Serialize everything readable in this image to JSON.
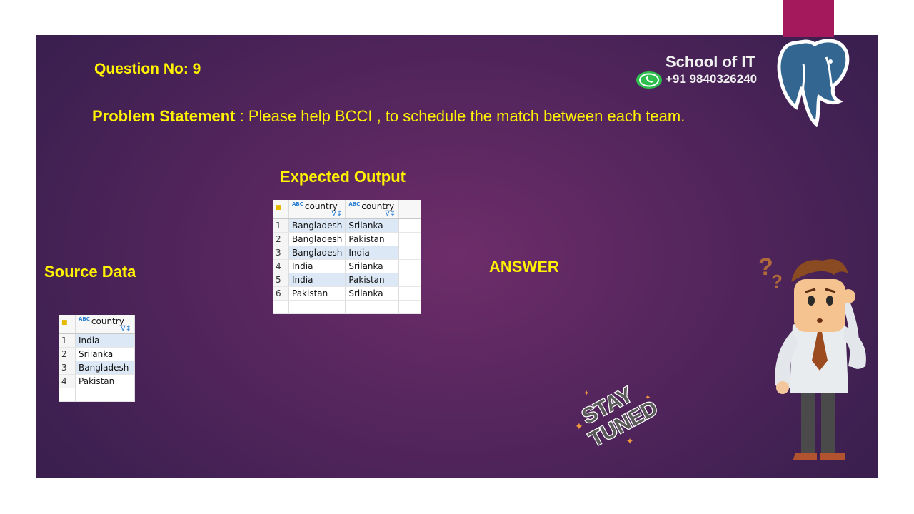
{
  "slide": {
    "question_label": "Question No: 9",
    "problem_label": "Problem Statement",
    "problem_text": " : Please help BCCI , to schedule the match between each team.",
    "school_name": "School of IT",
    "phone": "+91 9840326240",
    "expected_output_label": "Expected Output",
    "source_data_label": "Source Data",
    "answer_label": "ANSWER",
    "sticker_text_1": "STAY",
    "sticker_text_2": "TUNED",
    "colors": {
      "accent": "#fff200",
      "background": "#56265e",
      "tab": "#a3195b"
    },
    "icons": [
      "whatsapp-icon",
      "postgresql-elephant-icon",
      "confused-man-illustration",
      "stay-tuned-sticker"
    ]
  },
  "expected_output": {
    "columns": [
      "country",
      "country"
    ],
    "rows": [
      {
        "n": "1",
        "a": "Bangladesh",
        "b": "Srilanka"
      },
      {
        "n": "2",
        "a": "Bangladesh",
        "b": "Pakistan"
      },
      {
        "n": "3",
        "a": "Bangladesh",
        "b": "India"
      },
      {
        "n": "4",
        "a": "India",
        "b": "Srilanka"
      },
      {
        "n": "5",
        "a": "India",
        "b": "Pakistan"
      },
      {
        "n": "6",
        "a": "Pakistan",
        "b": "Srilanka"
      }
    ]
  },
  "source_data": {
    "column": "country",
    "rows": [
      {
        "n": "1",
        "v": "India"
      },
      {
        "n": "2",
        "v": "Srilanka"
      },
      {
        "n": "3",
        "v": "Bangladesh"
      },
      {
        "n": "4",
        "v": "Pakistan"
      }
    ]
  },
  "header_badge": "ABC"
}
